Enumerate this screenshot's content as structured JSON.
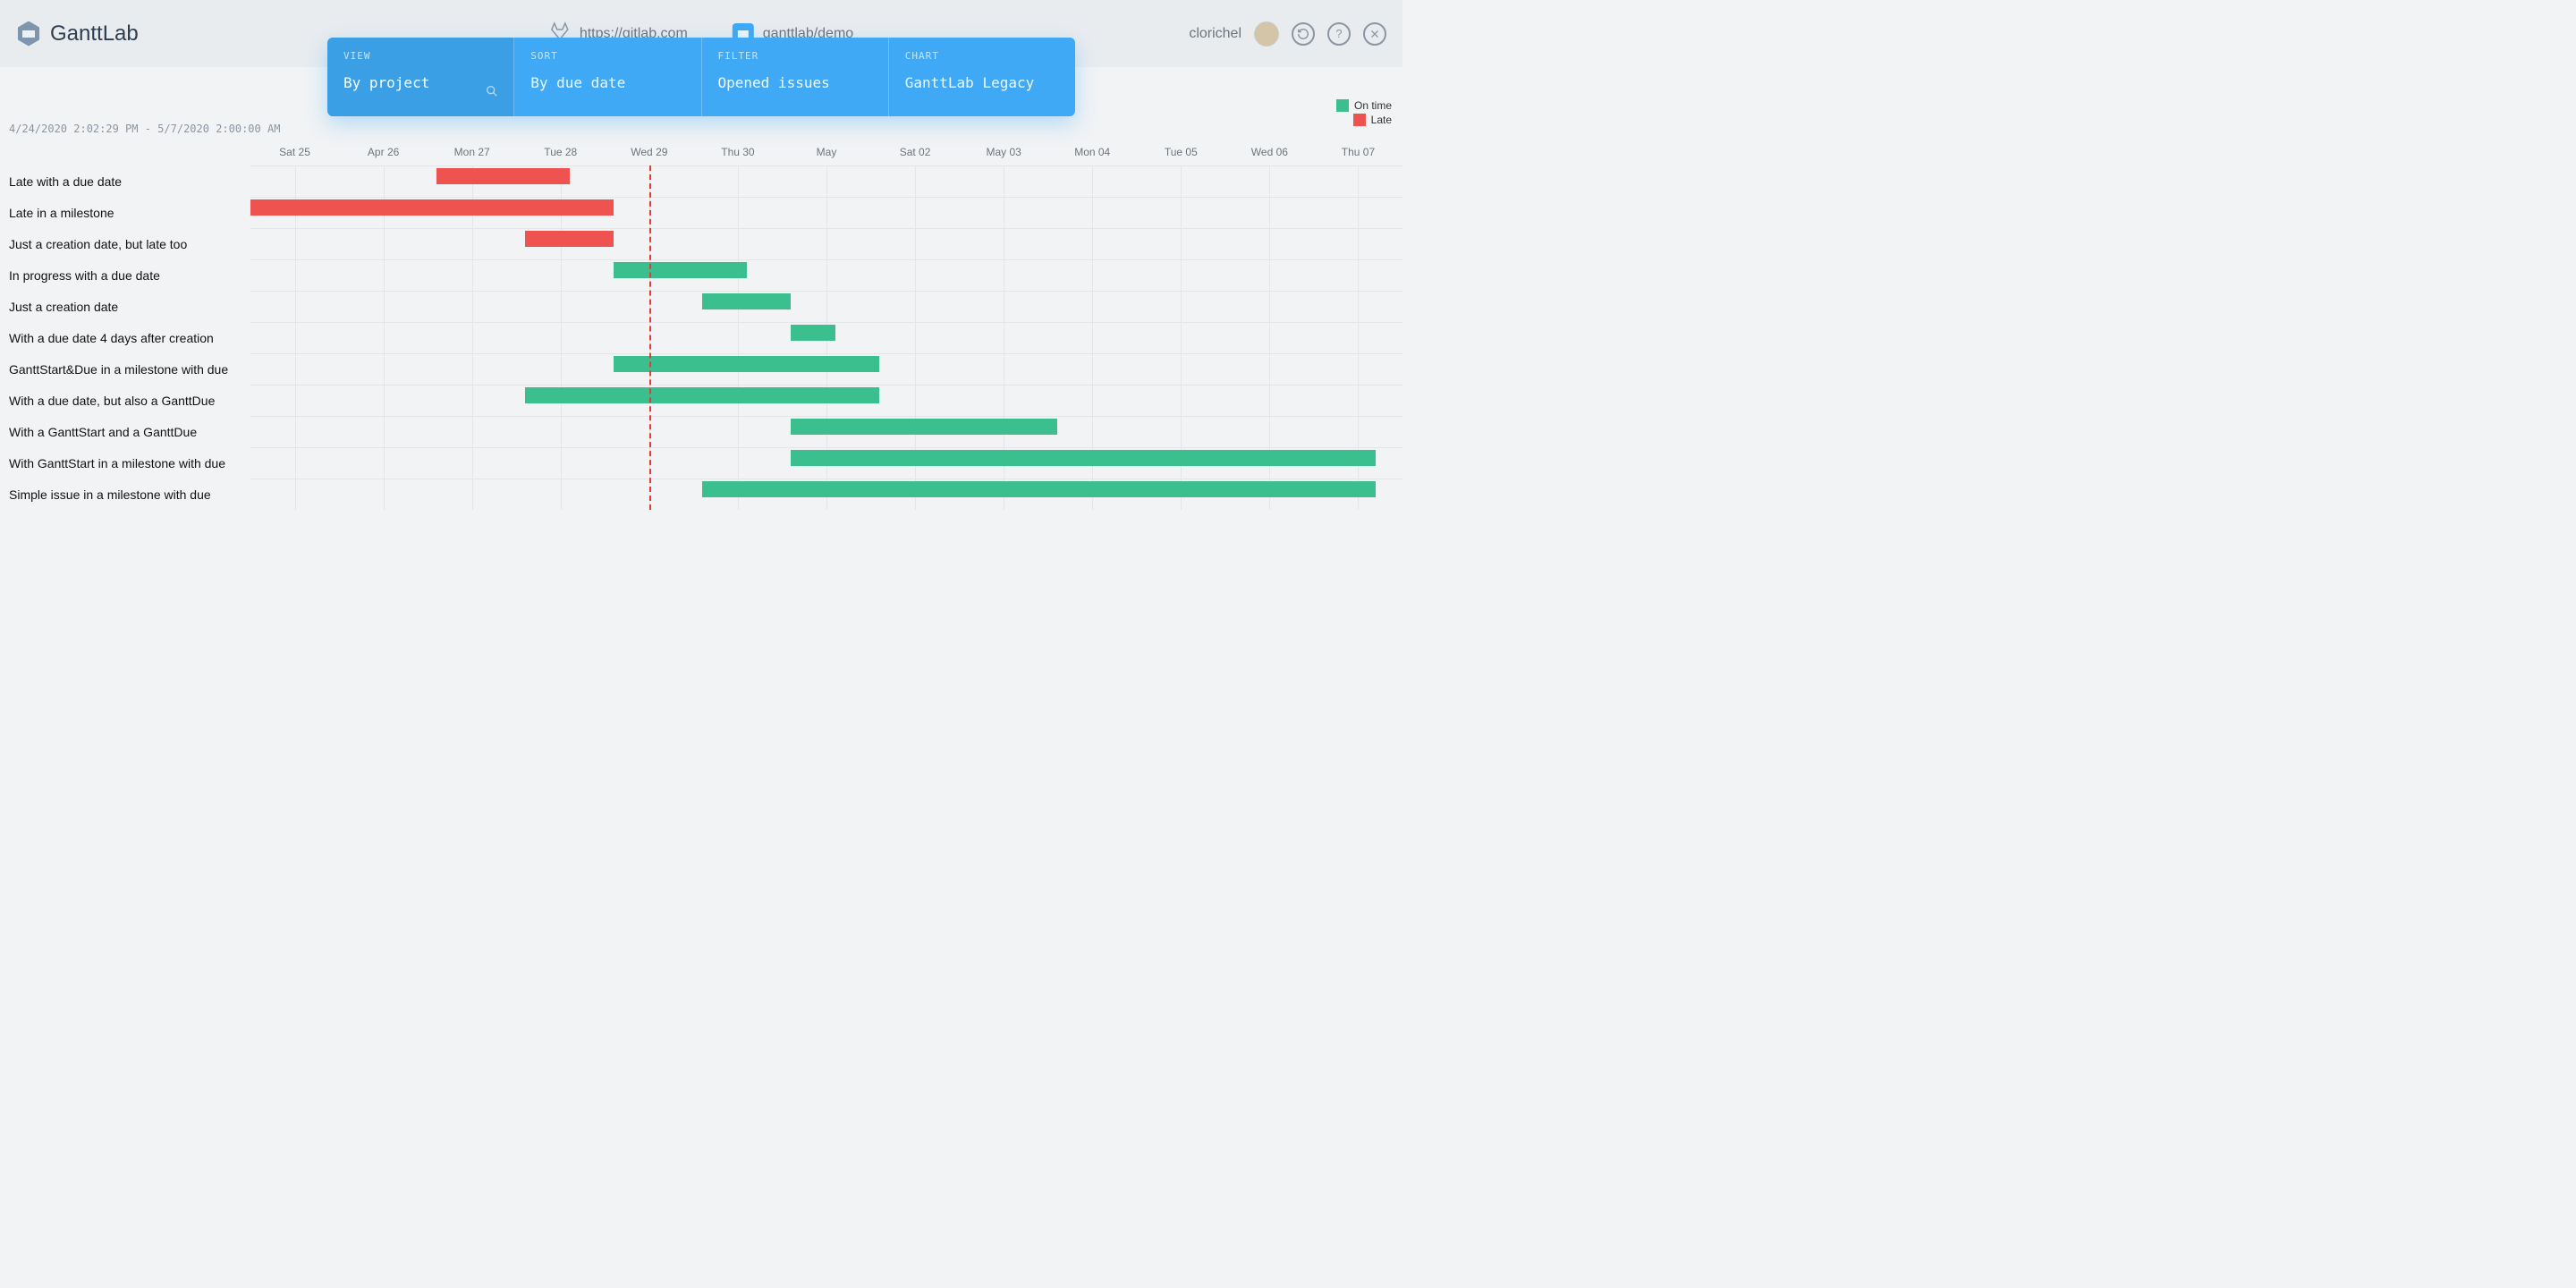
{
  "app": {
    "name": "GanttLab"
  },
  "header": {
    "gitlab_url": "https://gitlab.com",
    "project_path": "ganttlab/demo",
    "username": "clorichel"
  },
  "controls": {
    "view": {
      "label": "VIEW",
      "value": "By project"
    },
    "sort": {
      "label": "SORT",
      "value": "By due date"
    },
    "filter": {
      "label": "FILTER",
      "value": "Opened issues"
    },
    "chart": {
      "label": "CHART",
      "value": "GanttLab Legacy"
    }
  },
  "legend": {
    "ontime": "On time",
    "late": "Late"
  },
  "daterange": "4/24/2020 2:02:29 PM - 5/7/2020 2:00:00 AM",
  "chart_data": {
    "type": "gantt",
    "x_start": 24.5,
    "x_end": 37.5,
    "today": 29,
    "ticks": [
      {
        "x": 25,
        "label": "Sat 25"
      },
      {
        "x": 26,
        "label": "Apr 26"
      },
      {
        "x": 27,
        "label": "Mon 27"
      },
      {
        "x": 28,
        "label": "Tue 28"
      },
      {
        "x": 29,
        "label": "Wed 29"
      },
      {
        "x": 30,
        "label": "Thu 30"
      },
      {
        "x": 31,
        "label": "May"
      },
      {
        "x": 32,
        "label": "Sat 02"
      },
      {
        "x": 33,
        "label": "May 03"
      },
      {
        "x": 34,
        "label": "Mon 04"
      },
      {
        "x": 35,
        "label": "Tue 05"
      },
      {
        "x": 36,
        "label": "Wed 06"
      },
      {
        "x": 37,
        "label": "Thu 07"
      }
    ],
    "rows": [
      {
        "label": "Late with a due date",
        "start": 26.6,
        "end": 28.1,
        "status": "late"
      },
      {
        "label": "Late in a milestone",
        "start": 24.5,
        "end": 28.6,
        "status": "late"
      },
      {
        "label": "Just a creation date, but late too",
        "start": 27.6,
        "end": 28.6,
        "status": "late"
      },
      {
        "label": "In progress with a due date",
        "start": 28.6,
        "end": 30.1,
        "status": "ontime"
      },
      {
        "label": "Just a creation date",
        "start": 29.6,
        "end": 30.6,
        "status": "ontime"
      },
      {
        "label": "With a due date 4 days after creation",
        "start": 30.6,
        "end": 31.1,
        "status": "ontime"
      },
      {
        "label": "GanttStart&Due in a milestone with due",
        "start": 28.6,
        "end": 31.6,
        "status": "ontime"
      },
      {
        "label": "With a due date, but also a GanttDue",
        "start": 27.6,
        "end": 31.6,
        "status": "ontime"
      },
      {
        "label": "With a GanttStart and a GanttDue",
        "start": 30.6,
        "end": 33.6,
        "status": "ontime"
      },
      {
        "label": "With GanttStart in a milestone with due",
        "start": 30.6,
        "end": 37.2,
        "status": "ontime"
      },
      {
        "label": "Simple issue in a milestone with due",
        "start": 29.6,
        "end": 37.2,
        "status": "ontime"
      }
    ]
  },
  "colors": {
    "ontime": "#3cbf8f",
    "late": "#ef5350",
    "accent": "#3fa9f5"
  }
}
